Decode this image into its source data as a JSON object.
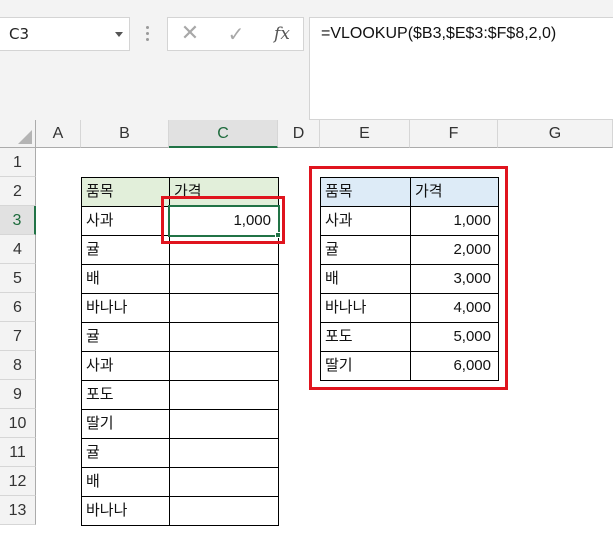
{
  "formula_bar": {
    "name_box": "C3",
    "cancel_glyph": "✕",
    "enter_glyph": "✓",
    "fx_label": "fx",
    "formula": "=VLOOKUP($B3,$E$3:$F$8,2,0)"
  },
  "columns": [
    "A",
    "B",
    "C",
    "D",
    "E",
    "F",
    "G"
  ],
  "selected_column": "C",
  "rows": [
    "1",
    "2",
    "3",
    "4",
    "5",
    "6",
    "7",
    "8",
    "9",
    "10",
    "11",
    "12",
    "13"
  ],
  "selected_row": "3",
  "left_table": {
    "header": [
      "품목",
      "가격"
    ],
    "items": [
      {
        "name": "사과",
        "price": "1,000"
      },
      {
        "name": "귤",
        "price": ""
      },
      {
        "name": "배",
        "price": ""
      },
      {
        "name": "바나나",
        "price": ""
      },
      {
        "name": "귤",
        "price": ""
      },
      {
        "name": "사과",
        "price": ""
      },
      {
        "name": "포도",
        "price": ""
      },
      {
        "name": "딸기",
        "price": ""
      },
      {
        "name": "귤",
        "price": ""
      },
      {
        "name": "배",
        "price": ""
      },
      {
        "name": "바나나",
        "price": ""
      }
    ]
  },
  "right_table": {
    "header": [
      "품목",
      "가격"
    ],
    "items": [
      {
        "name": "사과",
        "price": "1,000"
      },
      {
        "name": "귤",
        "price": "2,000"
      },
      {
        "name": "배",
        "price": "3,000"
      },
      {
        "name": "바나나",
        "price": "4,000"
      },
      {
        "name": "포도",
        "price": "5,000"
      },
      {
        "name": "딸기",
        "price": "6,000"
      }
    ]
  },
  "colors": {
    "accent_green": "#217346",
    "header_green": "#e2efda",
    "header_blue": "#ddebf7",
    "highlight_red": "#e0141e"
  }
}
